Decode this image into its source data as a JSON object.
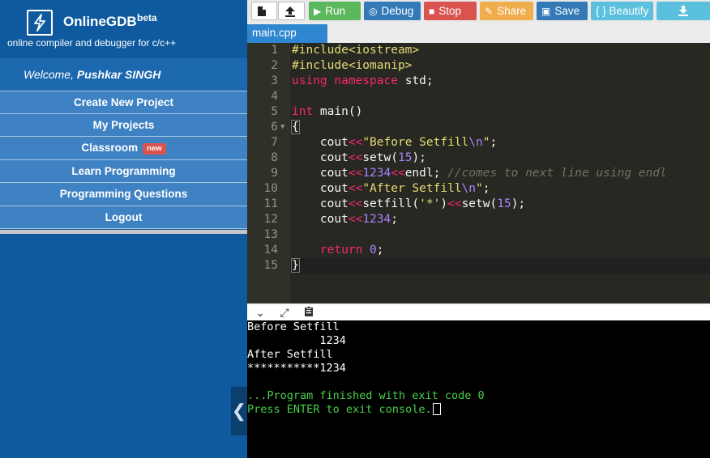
{
  "brand": {
    "name": "OnlineGDB",
    "beta": "beta",
    "tagline": "online compiler and debugger for c/c++"
  },
  "welcome": {
    "prefix": "Welcome, ",
    "user": "Pushkar SINGH"
  },
  "sidebar": {
    "items": [
      {
        "label": "Create New Project"
      },
      {
        "label": "My Projects"
      },
      {
        "label": "Classroom",
        "badge": "new"
      },
      {
        "label": "Learn Programming"
      },
      {
        "label": "Programming Questions"
      },
      {
        "label": "Logout"
      }
    ]
  },
  "toolbar": {
    "run": "Run",
    "debug": "Debug",
    "stop": "Stop",
    "share": "Share",
    "save": "Save",
    "beautify": "{ } Beautify"
  },
  "tab": {
    "label": "main.cpp"
  },
  "editor": {
    "line_numbers": [
      "1",
      "2",
      "3",
      "4",
      "5",
      "6",
      "7",
      "8",
      "9",
      "10",
      "11",
      "12",
      "13",
      "14",
      "15"
    ]
  },
  "console": {
    "lines": [
      "Before Setfill",
      "           1234",
      "After Setfill",
      "***********1234",
      ""
    ],
    "finished": "...Program finished with exit code 0",
    "prompt": "Press ENTER to exit console."
  },
  "colors": {
    "sidebar_bg": "#0f5a9e",
    "nav_item_bg": "#3f82c4",
    "run": "#5cb85c",
    "debug": "#337ab7",
    "stop": "#d9534f",
    "share": "#f0ad4e",
    "beautify": "#5bc0de",
    "editor_bg": "#272822",
    "console_green": "#4ad04a"
  },
  "icons": [
    "bolt-icon",
    "new-file-icon",
    "upload-icon",
    "play-icon",
    "debug-icon",
    "stop-icon",
    "share-icon",
    "save-icon",
    "download-icon",
    "chevron-down-icon",
    "expand-icon",
    "clipboard-icon",
    "chevron-left-icon"
  ]
}
